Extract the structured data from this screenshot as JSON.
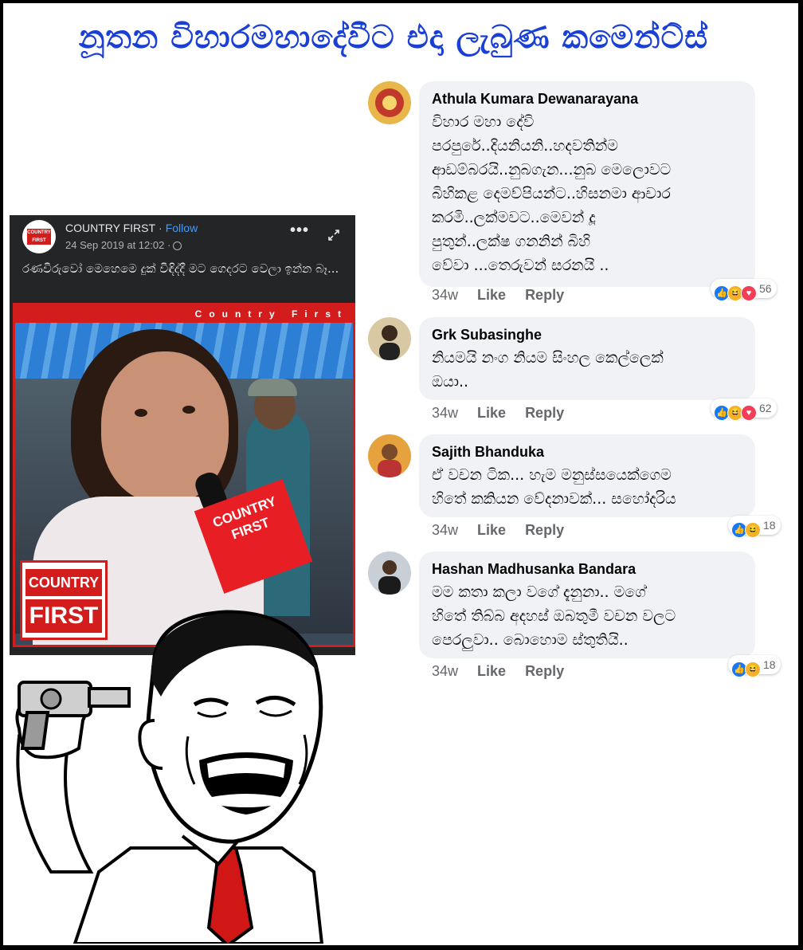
{
  "headline": "නූතන විහාරමහාදේවීට එදා ලැබුණ කමෙන්ට්ස්",
  "post": {
    "page_name": "COUNTRY FIRST",
    "separator": "·",
    "follow_label": "Follow",
    "date": "24 Sep 2019 at 12:02 ·",
    "more_icon": "more-icon",
    "more_label": "•••",
    "expand_icon": "expand-icon",
    "caption": "රණවිරුවෝ මෙහෙමෙ දුක් විඳිද්දී මට ගෙදරට වෙලා ඉන්න බෑ...",
    "avatar_logo_top": "COUNTRY",
    "avatar_logo_bottom": "FIRST",
    "photo_banner": "Country First",
    "mic_flag": "COUNTRY FIRST",
    "corner_logo_top": "COUNTRY",
    "corner_logo_bottom": "FIRST"
  },
  "comments": [
    {
      "name": "Athula Kumara Dewanarayana",
      "text": [
        "විහාර මහා දේවි",
        "පරපුරේ..දියනියනි..හදවතින්ම",
        "ආඩම්බරයි..නුබගැන...නුබ මෙලොවට",
        "බිහිකළ දෙමව්පියන්ට..හිසනමා ආචාර",
        "කරමි..ලක්මවට..මෙවන් දූ",
        "පුතුන්..ලක්ෂ ගනනින් බිහි",
        "වේවා ...තෙරුවන් සරනයි .."
      ],
      "time": "34w",
      "like": "Like",
      "reply": "Reply",
      "reactions": [
        "like",
        "haha",
        "love"
      ],
      "count": "56"
    },
    {
      "name": "Grk Subasinghe",
      "text": [
        "නියමයි නංග නියම සිංහල කෙල්ලෙක්",
        "ඔයා.."
      ],
      "time": "34w",
      "like": "Like",
      "reply": "Reply",
      "reactions": [
        "like",
        "haha",
        "love"
      ],
      "count": "62"
    },
    {
      "name": "Sajith Bhanduka",
      "text": [
        "ඒ වචන ටික... හැම මනුස්සයෙක්ගෙම",
        "හිතේ කකියන වේදනාවක්... සහෝදරිය"
      ],
      "time": "34w",
      "like": "Like",
      "reply": "Reply",
      "reactions": [
        "like",
        "haha"
      ],
      "count": "18"
    },
    {
      "name": "Hashan Madhusanka Bandara",
      "text": [
        "මම කතා කලා වගේ දැනුනා.. මගේ",
        "හිතේ තිබ්බ අදහස් ඔබතුමී වචන වලට",
        "පෙරලුවා.. බොහොම ස්තුතියි.."
      ],
      "time": "34w",
      "like": "Like",
      "reply": "Reply",
      "reactions": [
        "like",
        "haha"
      ],
      "count": "18"
    }
  ],
  "colors": {
    "headline": "#1a3fd4",
    "brand_red": "#d31c1c",
    "fb_like": "#1877f2",
    "fb_haha": "#f7b125",
    "fb_love": "#f33e58",
    "bubble": "#f0f2f5",
    "post_bg": "#242526"
  }
}
